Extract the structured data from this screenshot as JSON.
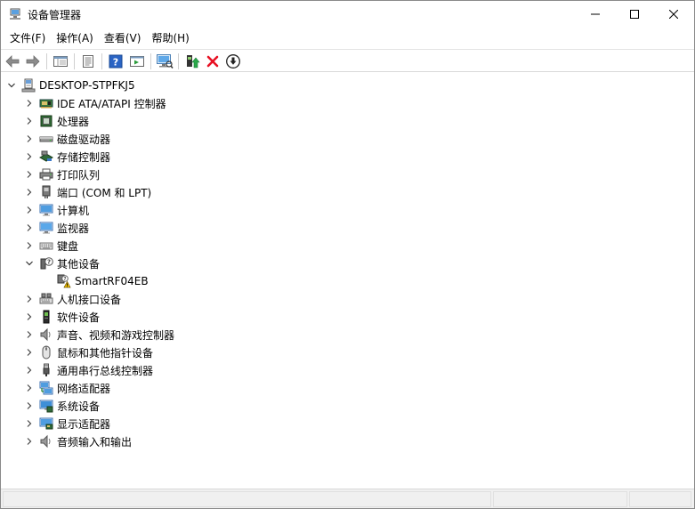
{
  "window": {
    "title": "设备管理器",
    "icon": "device-manager-icon"
  },
  "menubar": {
    "items": [
      "文件(F)",
      "操作(A)",
      "查看(V)",
      "帮助(H)"
    ]
  },
  "toolbar": {
    "buttons": [
      "back-icon",
      "forward-icon",
      "properties-list-icon",
      "properties-icon",
      "help-icon",
      "run-icon",
      "monitor-scan-icon",
      "update-driver-icon",
      "uninstall-icon",
      "download-icon"
    ]
  },
  "tree": {
    "root": {
      "label": "DESKTOP-STPFKJ5",
      "expanded": true,
      "icon": "computer-icon"
    },
    "categories": [
      {
        "label": "IDE ATA/ATAPI 控制器",
        "icon": "ide-controller-icon",
        "expanded": false
      },
      {
        "label": "处理器",
        "icon": "processor-icon",
        "expanded": false
      },
      {
        "label": "磁盘驱动器",
        "icon": "disk-drive-icon",
        "expanded": false
      },
      {
        "label": "存储控制器",
        "icon": "storage-controller-icon",
        "expanded": false
      },
      {
        "label": "打印队列",
        "icon": "printer-icon",
        "expanded": false
      },
      {
        "label": "端口 (COM 和 LPT)",
        "icon": "port-icon",
        "expanded": false
      },
      {
        "label": "计算机",
        "icon": "computer-monitor-icon",
        "expanded": false
      },
      {
        "label": "监视器",
        "icon": "monitor-icon",
        "expanded": false
      },
      {
        "label": "键盘",
        "icon": "keyboard-icon",
        "expanded": false
      },
      {
        "label": "其他设备",
        "icon": "other-devices-icon",
        "expanded": true,
        "children": [
          {
            "label": "SmartRF04EB",
            "icon": "warning-device-icon"
          }
        ]
      },
      {
        "label": "人机接口设备",
        "icon": "hid-icon",
        "expanded": false
      },
      {
        "label": "软件设备",
        "icon": "software-device-icon",
        "expanded": false
      },
      {
        "label": "声音、视频和游戏控制器",
        "icon": "sound-icon",
        "expanded": false
      },
      {
        "label": "鼠标和其他指针设备",
        "icon": "mouse-icon",
        "expanded": false
      },
      {
        "label": "通用串行总线控制器",
        "icon": "usb-icon",
        "expanded": false
      },
      {
        "label": "网络适配器",
        "icon": "network-adapter-icon",
        "expanded": false
      },
      {
        "label": "系统设备",
        "icon": "system-device-icon",
        "expanded": false
      },
      {
        "label": "显示适配器",
        "icon": "display-adapter-icon",
        "expanded": false
      },
      {
        "label": "音频输入和输出",
        "icon": "audio-io-icon",
        "expanded": false
      }
    ]
  },
  "colors": {
    "accent_blue": "#1e78d7",
    "uninstall_red": "#e81123",
    "warning_yellow": "#f6c500"
  }
}
